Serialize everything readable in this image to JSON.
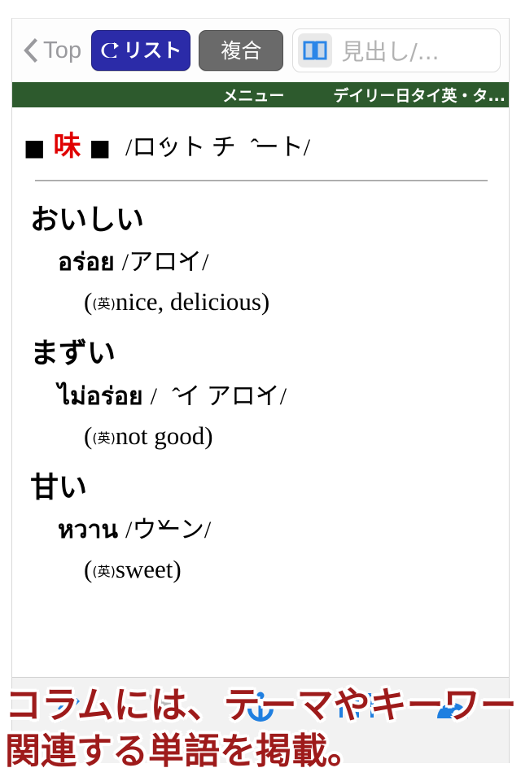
{
  "navbar": {
    "back_label": "Top",
    "back_icon": "chevron-left-icon",
    "list_button_label": "リスト",
    "list_button_icon": "refresh-circle-arrow-icon",
    "list_button_color": "#2b2ba8",
    "compound_button_label": "複合",
    "compound_button_color": "#6a6a6a",
    "search_icon": "open-book-icon",
    "search_value": "",
    "search_placeholder": "見出し/..."
  },
  "menubar": {
    "menu_label": "メニュー",
    "dictionary_label": "デイリー日タイ英・タ...",
    "background_color": "#2d5a2d"
  },
  "article": {
    "marker_left": "■",
    "keyword": "味",
    "keyword_color": "#e00000",
    "marker_right": "■",
    "transliteration": "/ロ́ット チャ̂ート/",
    "entries": [
      {
        "japanese": "おいしい",
        "thai": "อร่อย",
        "kana": "/アロ̀イ/",
        "lang_tag": "(英)",
        "english": "nice, delicious"
      },
      {
        "japanese": "まずい",
        "thai": "ไม่อร่อย",
        "kana": "/マ̂イ アロ̀イ/",
        "lang_tag": "(英)",
        "english": "not good"
      },
      {
        "japanese": "甘い",
        "thai": "หวาน",
        "kana": "/ウ̌ーン/",
        "lang_tag": "(英)",
        "english": "sweet"
      }
    ]
  },
  "toolbar": {
    "items": [
      {
        "icon": "bookmark-pin-icon",
        "color": "#1f7fe0"
      },
      {
        "icon": "play-triangle-icon",
        "color": "#b8b8b8"
      },
      {
        "icon": "anchor-icon",
        "color": "#1f7fe0"
      },
      {
        "icon": "open-book-outline-icon",
        "color": "#1f7fe0"
      },
      {
        "icon": "person-circle-icon",
        "color": "#1f7fe0"
      }
    ]
  },
  "caption": {
    "line1": "コラムには、テーマやキーワードごとに",
    "line2": "関連する単語を掲載。",
    "color": "#9e1b1b",
    "outline_color": "#ffffff"
  }
}
